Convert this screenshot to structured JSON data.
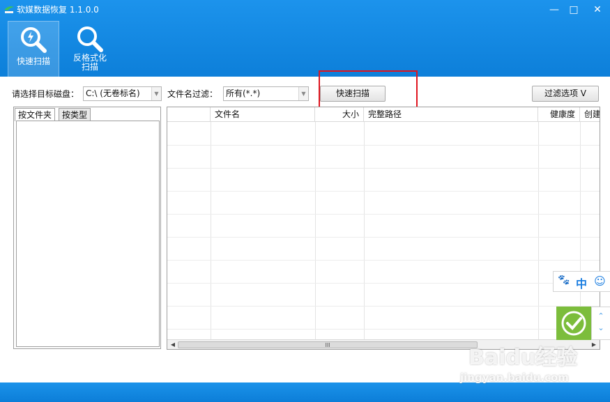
{
  "window": {
    "title": "软媒数据恢复 1.1.0.0",
    "minimize_glyph": "—",
    "maximize_glyph": "□",
    "close_glyph": "✕"
  },
  "toolbar": {
    "quick_scan_label": "快速扫描",
    "unformat_scan_label_line1": "反格式化",
    "unformat_scan_label_line2": "扫描"
  },
  "controls": {
    "disk_label": "请选择目标磁盘：",
    "disk_value": "C:\\  (无卷标名)",
    "filter_label": "文件名过滤：",
    "filter_value": "所有(*.*)",
    "scan_button": "快速扫描",
    "filter_options_button": "过滤选项  V"
  },
  "left_panel": {
    "tabs": [
      "按文件夹",
      "按类型"
    ]
  },
  "file_table": {
    "columns": [
      "",
      "文件名",
      "大小",
      "完整路径",
      "健康度",
      "创建"
    ],
    "rows": []
  },
  "scrollbar": {
    "left_arrow": "◀",
    "right_arrow": "▶",
    "thumb_grip": "III"
  },
  "floating_widget": {
    "icons": [
      "paw-icon",
      "chinese-input-icon",
      "smiley-icon",
      "checkmark-icon"
    ],
    "chinese_char": "中",
    "smiley": "☺",
    "paw": "🐾",
    "up": "⌃",
    "down": "⌄"
  },
  "watermark": {
    "logo_text": "Baidu经验",
    "url_text": "jingyan.baidu.com"
  },
  "colors": {
    "titlebar": "#1c93ec",
    "highlight_box": "#e0141e",
    "accent_green": "#7cbd3c"
  }
}
